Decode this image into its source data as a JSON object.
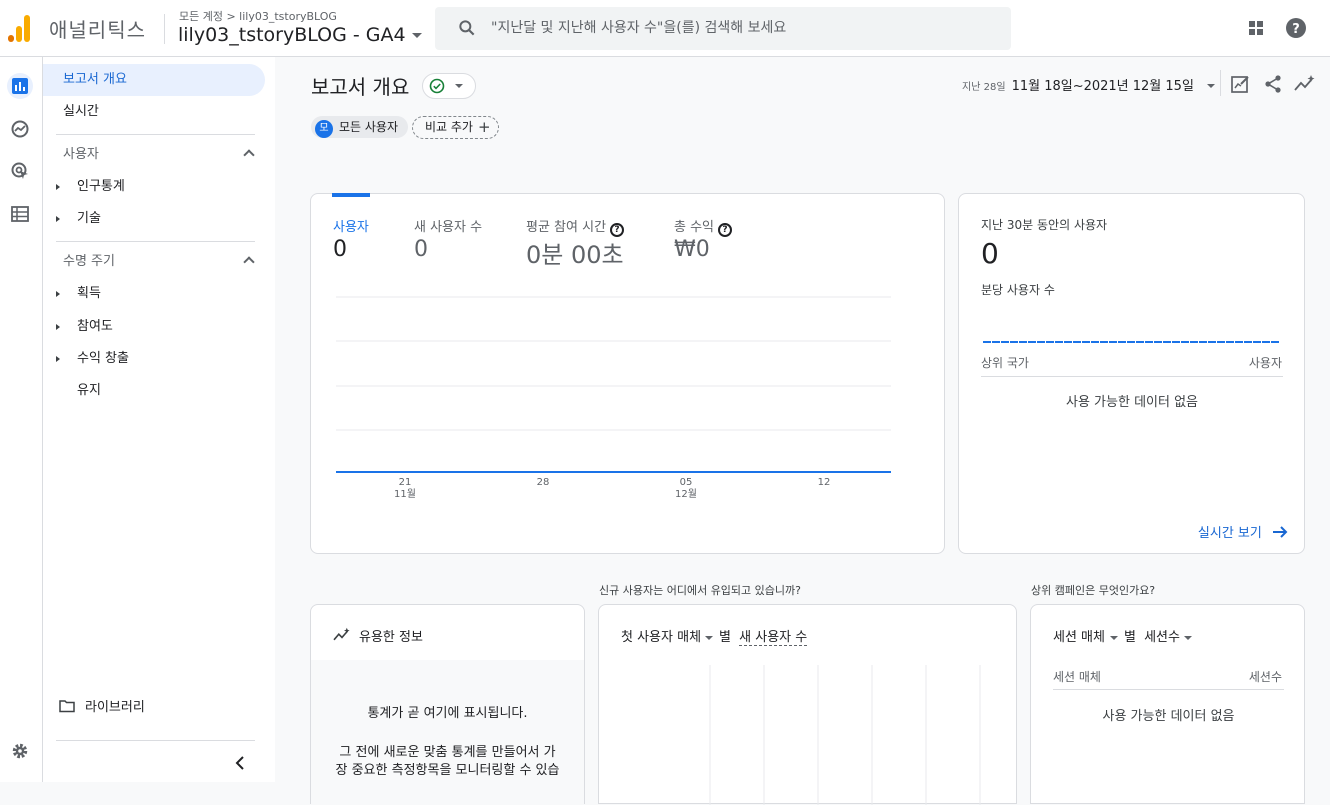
{
  "app": {
    "brand": "애널리틱스",
    "breadcrumb": "모든 계정 > lily03_tstoryBLOG",
    "property": "lily03_tstoryBLOG - GA4",
    "search_placeholder": "\"지난달 및 지난해 사용자 수\"을(를) 검색해 보세요",
    "colors": {
      "accent": "#1a73e8",
      "logo_orange": "#f9ab00",
      "logo_dark": "#e37400"
    }
  },
  "sidebar": {
    "items": [
      {
        "label": "보고서 개요",
        "active": true
      },
      {
        "label": "실시간"
      }
    ],
    "section_users": "사용자",
    "users_items": [
      "인구통계",
      "기술"
    ],
    "section_lifecycle": "수명 주기",
    "lifecycle_items": [
      "획득",
      "참여도",
      "수익 창출",
      "유지"
    ],
    "library": "라이브러리"
  },
  "header": {
    "title": "보고서 개요",
    "date_prefix": "지난 28일",
    "date_range": "11월 18일~2021년 12월 15일",
    "segment_avatar": "모",
    "segment": "모든 사용자",
    "add_compare": "비교 추가"
  },
  "metrics_card": {
    "metrics": [
      {
        "label": "사용자",
        "value": "0"
      },
      {
        "label": "새 사용자 수",
        "value": "0"
      },
      {
        "label": "평균 참여 시간",
        "value": "0분 00초"
      },
      {
        "label": "총 수익",
        "value": "₩0"
      }
    ],
    "x_ticks": [
      {
        "day": "21",
        "month": "11월"
      },
      {
        "day": "28",
        "month": ""
      },
      {
        "day": "05",
        "month": "12월"
      },
      {
        "day": "12",
        "month": ""
      }
    ]
  },
  "realtime_card": {
    "title": "지난 30분 동안의 사용자",
    "value": "0",
    "sub": "분당 사용자 수",
    "col_left": "상위 국가",
    "col_right": "사용자",
    "no_data": "사용 가능한 데이터 없음",
    "link": "실시간 보기"
  },
  "bottom": {
    "question_source": "신규 사용자는 어디에서 유입되고 있습니까?",
    "question_campaign": "상위 캠페인은 무엇인가요?",
    "insights_title": "유용한 정보",
    "insights_line1": "통계가 곧 여기에 표시됩니다.",
    "insights_line2": "그 전에 새로운 맞춤 통계를 만들어서 가",
    "insights_line3": "장 중요한 측정항목을 모니터링할 수 있습",
    "source_dim": "첫 사용자 매체",
    "source_by": "별",
    "source_metric": "새 사용자 수",
    "campaign_dim": "세션 매체",
    "campaign_by": "별",
    "campaign_metric": "세션수",
    "campaign_col_left": "세션 매체",
    "campaign_col_right": "세션수",
    "campaign_no_data": "사용 가능한 데이터 없음"
  }
}
